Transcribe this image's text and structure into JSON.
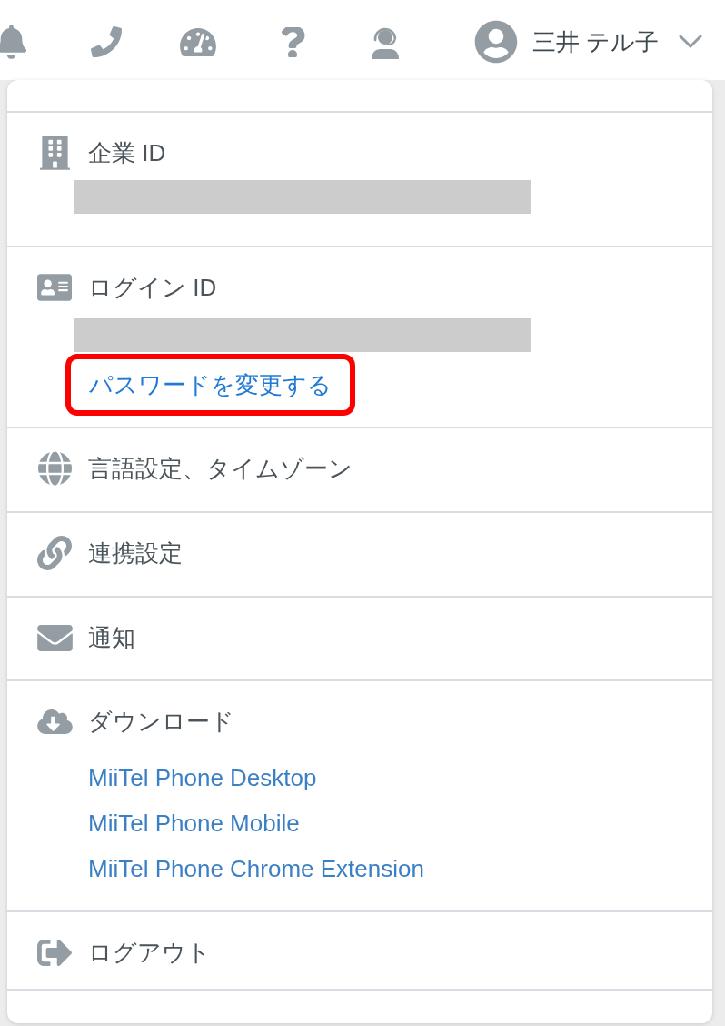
{
  "top_bar": {
    "user_name": "三井 テル子"
  },
  "menu": {
    "sections": [
      {
        "kind": "id",
        "label": "企業 ID",
        "value_redacted": true
      },
      {
        "kind": "id",
        "label": "ログイン ID",
        "value_redacted": true,
        "link": {
          "label": "パスワードを変更する",
          "highlighted": true
        }
      },
      {
        "kind": "item",
        "label": "言語設定、タイムゾーン"
      },
      {
        "kind": "item",
        "label": "連携設定"
      },
      {
        "kind": "item",
        "label": "通知"
      },
      {
        "kind": "downloads",
        "label": "ダウンロード",
        "links": [
          "MiiTel Phone Desktop",
          "MiiTel Phone Mobile",
          "MiiTel Phone Chrome Extension"
        ]
      },
      {
        "kind": "item",
        "label": "ログアウト"
      }
    ]
  }
}
